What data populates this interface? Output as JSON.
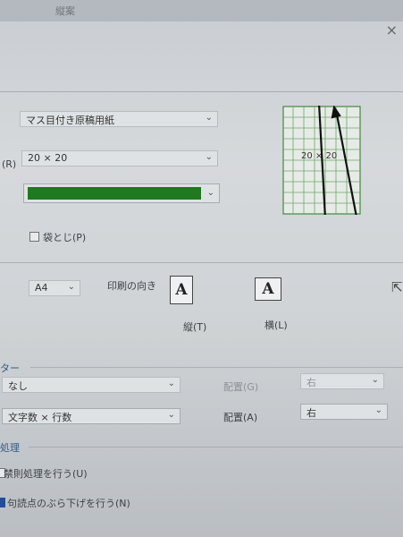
{
  "title_text": "縦案",
  "paper": {
    "style_value": "マス目付き原稿用紙",
    "grid_label": "(R)",
    "grid_value": "20 × 20",
    "color": "#1d7a1d"
  },
  "binding": {
    "label": "袋とじ(P)",
    "checked": false
  },
  "preview": {
    "label": "20 × 20"
  },
  "page": {
    "size_value": "A4",
    "orientation_label": "印刷の向き",
    "portrait_label": "縦(T)",
    "landscape_label": "横(L)",
    "glyph": "A"
  },
  "footer_section": {
    "title": "ター",
    "row1": {
      "value": "なし",
      "align_label": "配置(G)",
      "align_value": "右"
    },
    "row2": {
      "value": "文字数 × 行数",
      "align_label": "配置(A)",
      "align_value": "右"
    }
  },
  "processing": {
    "title": "処理",
    "opt1": {
      "label": "禁則処理を行う(U)",
      "checked": false
    },
    "opt2": {
      "label": "句読点のぶら下げを行う(N)",
      "checked": true
    }
  },
  "icons": {
    "chevron": "⌄",
    "close": "×",
    "cursor": "⇱"
  }
}
